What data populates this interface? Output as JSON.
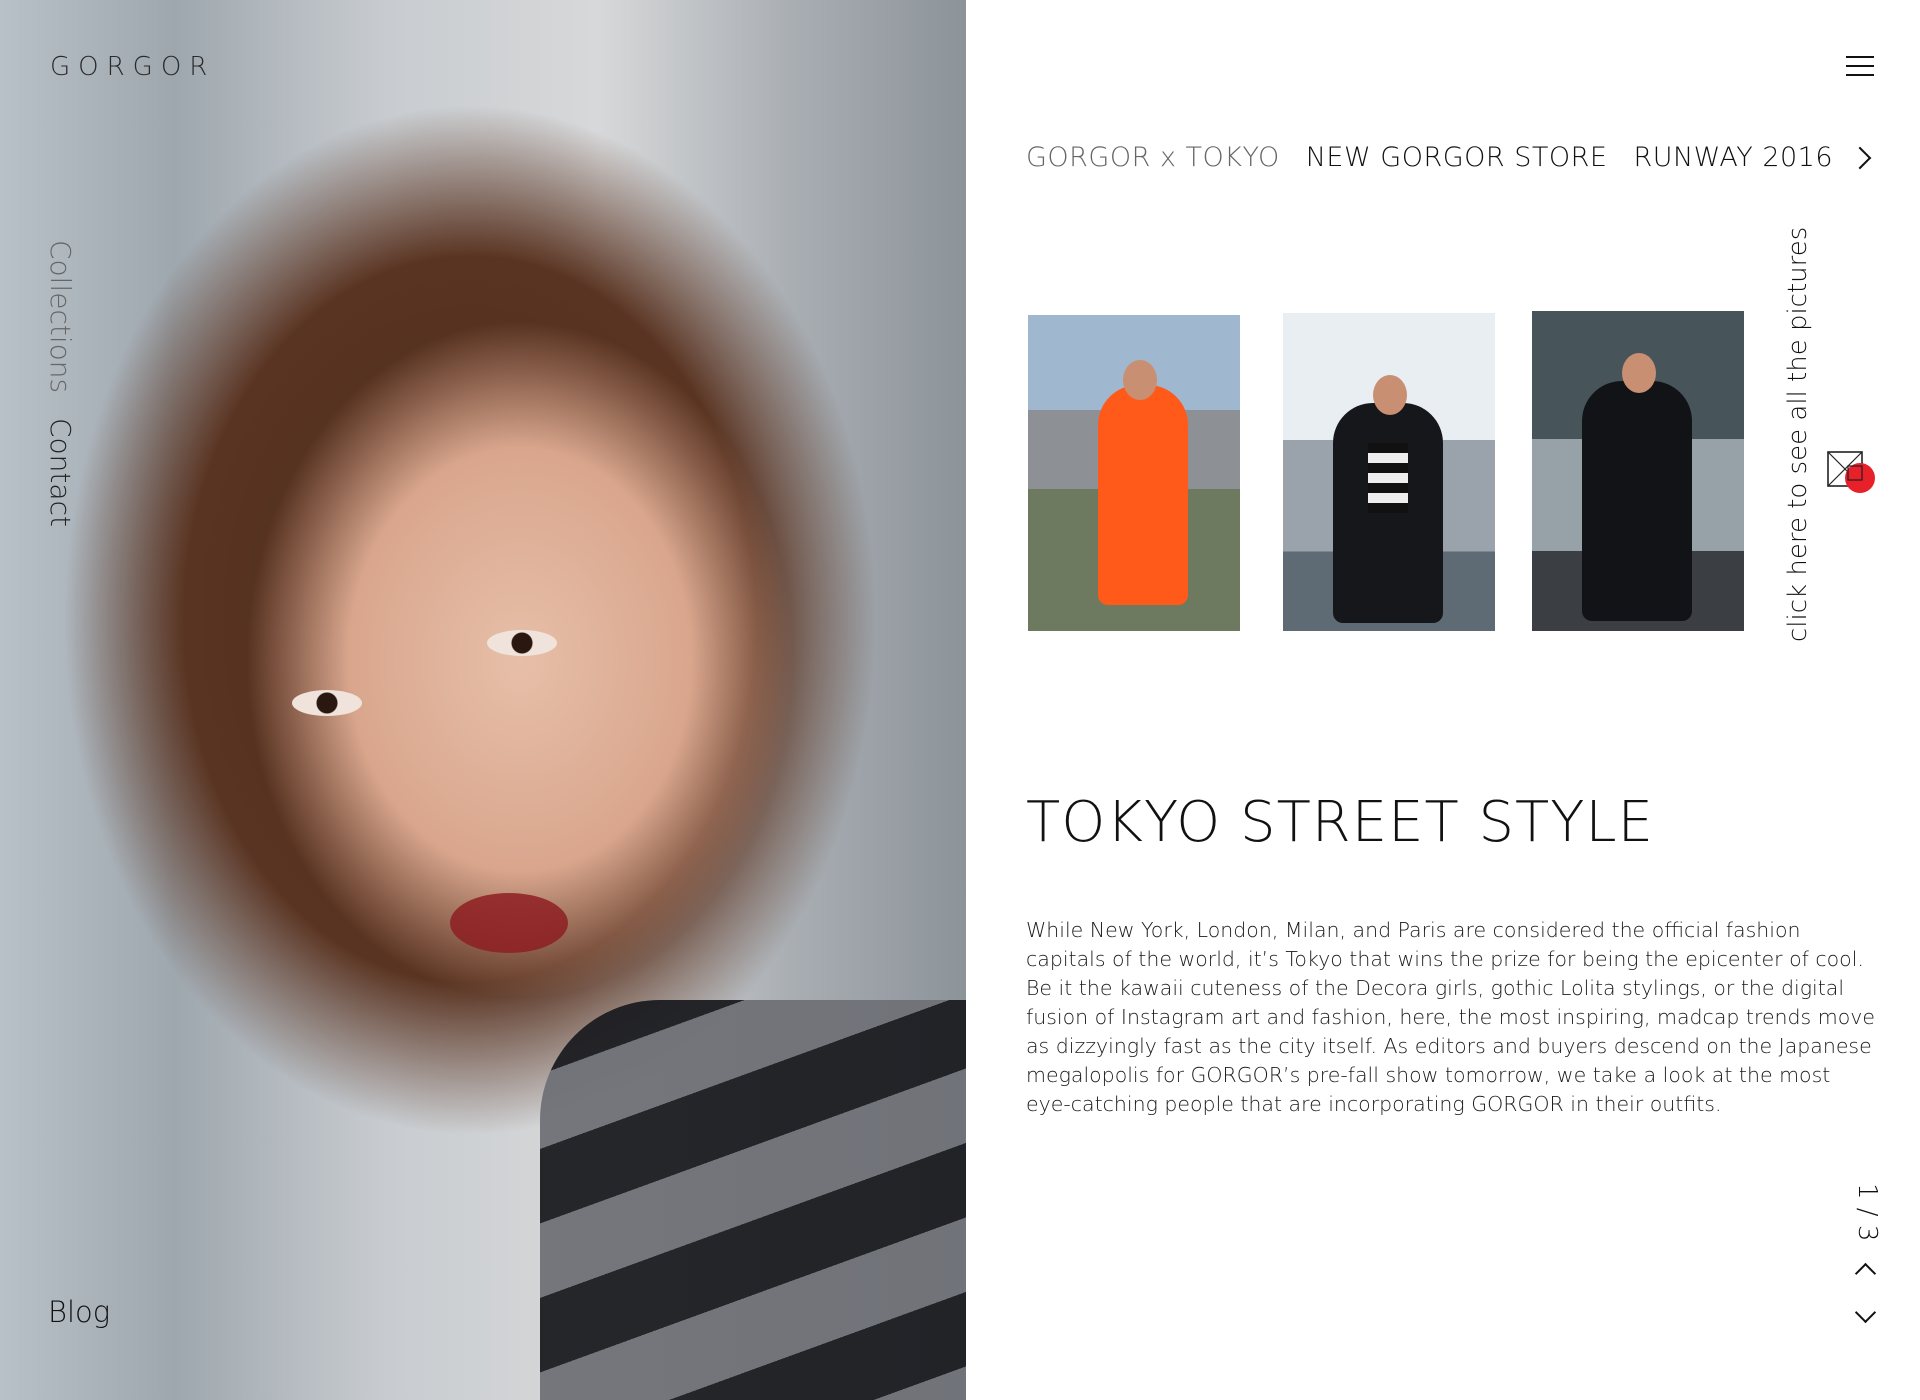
{
  "brand": {
    "logo_text": "GORGOR"
  },
  "side_nav": {
    "items": [
      {
        "label": "Collections"
      },
      {
        "label": "Contact"
      }
    ],
    "blog_label": "Blog"
  },
  "header": {
    "menu_icon": "hamburger-menu-icon",
    "tabs": [
      {
        "label": "GORGOR x TOKYO",
        "active": true
      },
      {
        "label": "NEW GORGOR STORE",
        "active": false
      },
      {
        "label": "RUNWAY 2016",
        "active": false
      }
    ],
    "next_icon": "chevron-right-icon"
  },
  "gallery": {
    "see_all_label": "click here to see all the pictures",
    "icon": "gallery-icon",
    "accent_color": "#e8202a",
    "thumbnails": [
      {
        "icon": "photo-thumbnail-1"
      },
      {
        "icon": "photo-thumbnail-2"
      },
      {
        "icon": "photo-thumbnail-3"
      }
    ]
  },
  "article": {
    "title": "TOKYO STREET STYLE",
    "body": "While New York, London, Milan, and Paris are considered the official fashion capitals of the world, it’s Tokyo that wins the prize for being the epicenter of cool. Be it the kawaii cuteness of the Decora girls, gothic Lolita stylings, or the digital fusion of Instagram art and fashion, here, the most inspiring, madcap trends move as dizzyingly fast as the city itself. As editors and buyers descend on the Japanese megalopolis for GORGOR’s pre-fall show tomorrow, we take a look at the most eye-catching people that are incorporating GORGOR in their outfits."
  },
  "pagination": {
    "label": "1 / 3",
    "prev_icon": "chevron-up-icon",
    "next_icon": "chevron-down-icon"
  }
}
